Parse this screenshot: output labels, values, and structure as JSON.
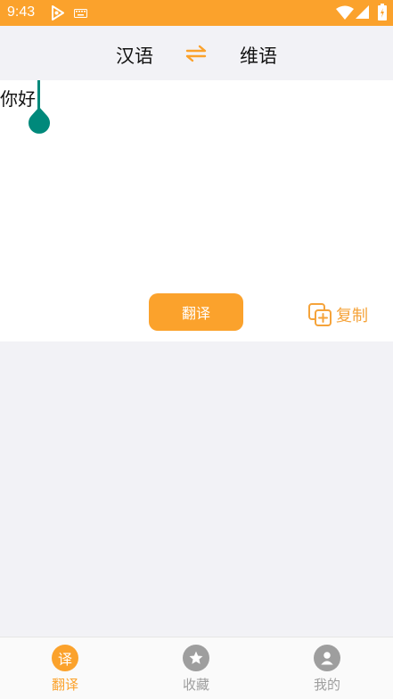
{
  "status_bar": {
    "time": "9:43"
  },
  "header": {
    "source_lang": "汉语",
    "target_lang": "维语"
  },
  "editor": {
    "input_text": "你好"
  },
  "actions": {
    "translate_label": "翻译",
    "copy_label": "复制"
  },
  "bottom_nav": {
    "items": [
      {
        "label": "翻译",
        "icon_text": "译",
        "active": true
      },
      {
        "label": "收藏",
        "active": false
      },
      {
        "label": "我的",
        "active": false
      }
    ]
  },
  "colors": {
    "accent": "#FBA22C",
    "cursor": "#00897B",
    "inactive": "#9E9E9E"
  }
}
